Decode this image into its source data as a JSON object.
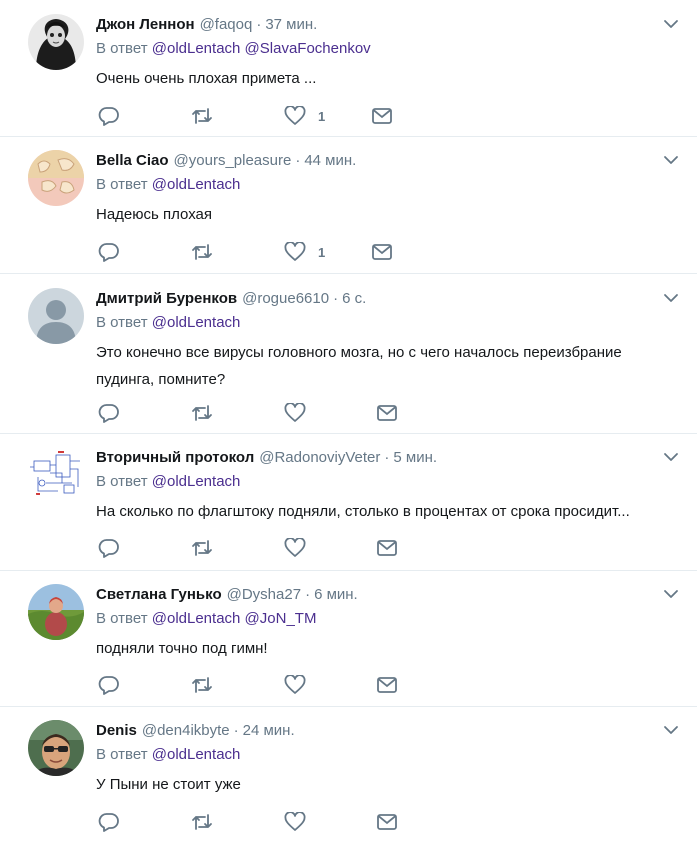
{
  "tweets": [
    {
      "name": "Джон Леннон",
      "handle": "@faqoq",
      "time": "37 мин.",
      "reply_prefix": "В ответ",
      "mentions": [
        "@oldLentach",
        "@SlavaFochenkov"
      ],
      "text_lines": [
        "Очень очень плохая примета ..."
      ],
      "likes": "1",
      "avatar_colors": [
        "#e8e8e8",
        "#1a1a1a"
      ]
    },
    {
      "name": "Bella Ciao",
      "handle": "@yours_pleasure",
      "time": "44 мин.",
      "reply_prefix": "В ответ",
      "mentions": [
        "@oldLentach"
      ],
      "text_lines": [
        "Надеюсь плохая"
      ],
      "likes": "1",
      "avatar_colors": [
        "#f1c6b8",
        "#e8c89a"
      ]
    },
    {
      "name": "Дмитрий Буренков",
      "handle": "@rogue6610",
      "time": "6 с.",
      "reply_prefix": "В ответ",
      "mentions": [
        "@oldLentach"
      ],
      "text_lines": [
        "Это конечно все вирусы головного мозга, но с чего началось переизбрание",
        "пудинга, помните?"
      ],
      "likes": "",
      "avatar_colors": [
        "#ccd6dd",
        "#8899a6"
      ]
    },
    {
      "name": "Вторичный протокол",
      "handle": "@RadonoviyVeter",
      "time": "5 мин.",
      "reply_prefix": "В ответ",
      "mentions": [
        "@oldLentach"
      ],
      "text_lines": [
        "На сколько по флагштоку подняли, столько в процентах от срока просидит..."
      ],
      "likes": "",
      "avatar_colors": [
        "#ffffff",
        "#3b5bbf"
      ]
    },
    {
      "name": "Светлана Гунько",
      "handle": "@Dysha27",
      "time": "6 мин.",
      "reply_prefix": "В ответ",
      "mentions": [
        "@oldLentach",
        "@JoN_TM"
      ],
      "text_lines": [
        "подняли точно под гимн!"
      ],
      "likes": "",
      "avatar_colors": [
        "#6f9a3a",
        "#8fb4d8"
      ]
    },
    {
      "name": "Denis",
      "handle": "@den4ikbyte",
      "time": "24 мин.",
      "reply_prefix": "В ответ",
      "mentions": [
        "@oldLentach"
      ],
      "text_lines": [
        "У Пыни не стоит уже"
      ],
      "likes": "",
      "avatar_colors": [
        "#d8b088",
        "#5a7a5a"
      ]
    }
  ],
  "icons": {
    "reply": "reply-icon",
    "retweet": "retweet-icon",
    "like": "heart-icon",
    "dm": "envelope-icon",
    "caret": "chevron-down-icon"
  },
  "colors": {
    "text": "#14171a",
    "secondary": "#657786",
    "mention": "#4b2f8f",
    "divider": "#e6ecf0"
  }
}
